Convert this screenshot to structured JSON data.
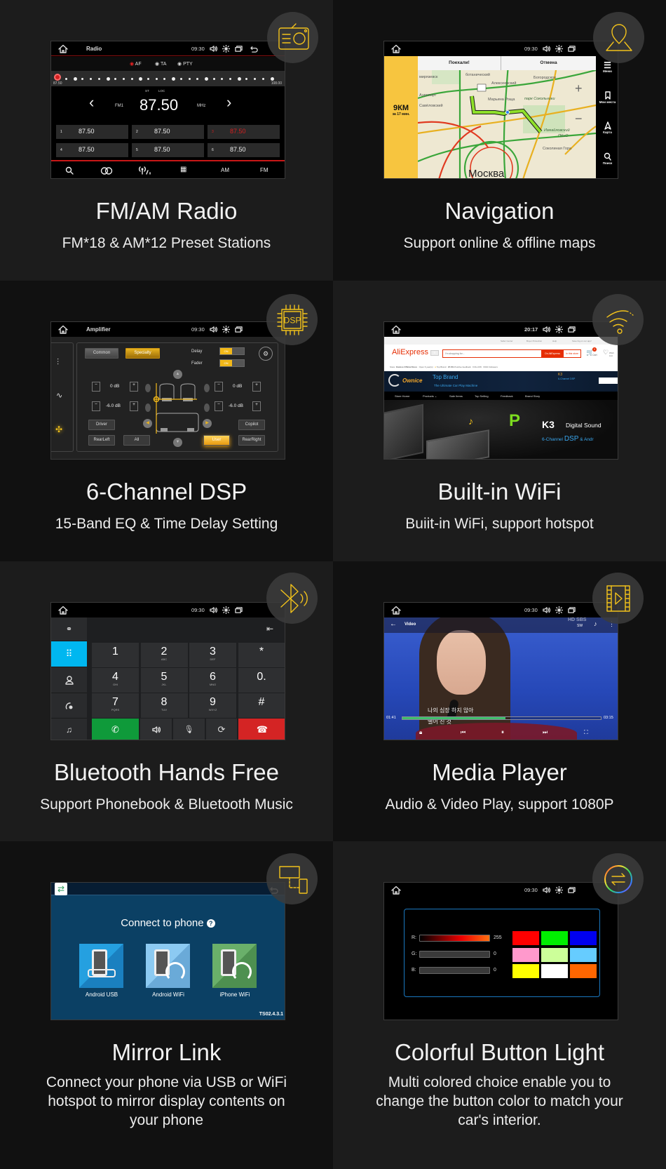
{
  "colors": {
    "accent": "#f2c21b",
    "tile_light": "#1c1c1c",
    "tile_dark": "#111111",
    "radio_red": "#d32020",
    "keypad_cyan": "#00b7f0",
    "call_green": "#0f9a3a",
    "hangup_red": "#d42424",
    "progress_green": "#3fbf6a",
    "aliexpress_red": "#e62e04"
  },
  "features": [
    {
      "title": "FM/AM Radio",
      "subtitle": "FM*18 & AM*12 Preset Stations",
      "icon": "radio-icon"
    },
    {
      "title": "Navigation",
      "subtitle": "Support online & offline maps",
      "icon": "map-pin-icon"
    },
    {
      "title": "6-Channel DSP",
      "subtitle": "15-Band EQ & Time Delay Setting",
      "icon": "dsp-chip-icon"
    },
    {
      "title": "Built-in WiFi",
      "subtitle": "Buiit-in WiFi, support hotspot",
      "icon": "wifi-icon"
    },
    {
      "title": "Bluetooth Hands Free",
      "subtitle": "Support Phonebook & Bluetooth Music",
      "icon": "bluetooth-icon"
    },
    {
      "title": "Media Player",
      "subtitle": "Audio & Video Play, support 1080P",
      "icon": "video-play-icon"
    },
    {
      "title": "Mirror Link",
      "subtitle_lines": [
        "Connect your phone via USB or WiFi",
        "hotspot to mirror display contents on",
        "your phone"
      ],
      "icon": "screen-phone-icon"
    },
    {
      "title": "Colorful Button Light",
      "subtitle_lines": [
        "Multi colored choice enable you to",
        "change the button color to match your",
        "car's interior."
      ],
      "icon": "color-ring-icon"
    }
  ],
  "radio": {
    "title": "Radio",
    "time": "09:30",
    "options": [
      "AF",
      "TA",
      "PTY"
    ],
    "range_min": "87.50",
    "range_max": "108.00",
    "st": "ST",
    "loc": "LOC",
    "band": "FM1",
    "frequency": "87.50",
    "unit": "MHz",
    "presets": [
      {
        "n": "1",
        "v": "87.50"
      },
      {
        "n": "2",
        "v": "87.50"
      },
      {
        "n": "3",
        "v": "87.50",
        "active": true
      },
      {
        "n": "4",
        "v": "87.50"
      },
      {
        "n": "5",
        "v": "87.50"
      },
      {
        "n": "6",
        "v": "87.50"
      }
    ],
    "bottom": [
      "AM",
      "FM"
    ]
  },
  "navigation": {
    "time": "09:30",
    "go": "Поехали!",
    "cancel": "Отмена",
    "distance": "9КМ",
    "eta": "за 17 мин.",
    "side": [
      "Меню",
      "Мои места",
      "Карта",
      "Поиск"
    ],
    "labels": {
      "city": "Москва",
      "park": "парк Сокольники",
      "bog": "Богородское",
      "izm": "Измайловский",
      "pkio": "ПКиО",
      "sok": "Соколиная Гора",
      "aer": "Аэропорт",
      "sav": "Савёловский",
      "alex": "Алексеевский",
      "mar": "Марьина Роща",
      "bot": "ботанический",
      "mir": "мирязевск"
    }
  },
  "dsp": {
    "title": "Amplifier",
    "time": "09:30",
    "modes": [
      "Common",
      "Specialty"
    ],
    "delay": "Delay",
    "fader": "Fader",
    "on": "ON",
    "levels": [
      "0 dB",
      "0 dB",
      "-6.0 dB",
      "-6.0 dB"
    ],
    "buttons": [
      "Driver",
      "Copilot",
      "RearLeft",
      "All",
      "User",
      "RearRight"
    ]
  },
  "wifi": {
    "time": "20:17",
    "topbar": [
      "Seller Center",
      "Buyer Protection",
      "Help",
      "Save big on our app!"
    ],
    "logo": "AliExpress",
    "search_placeholder": "I'm shopping for...",
    "on_ali": "On AliExpress",
    "in_store": "In this store",
    "cart": "Cart",
    "cart_count": "0",
    "wish": "Wish List",
    "store_line": [
      "Store:",
      "Ownice Official Store",
      "Open 6 year(s)",
      "Top Brand",
      "97.6%",
      "Positive feedback",
      "FOLLOW",
      "6332 Followers"
    ],
    "brand": "Ownice",
    "banner_title": "Top Brand",
    "banner_sub": "The Ultimate Car Play Machine",
    "banner_k3": "K3",
    "banner_k3_sub": "6-Channel DSP",
    "nav": [
      "Store Home",
      "Products",
      "Sale Items",
      "Top Selling",
      "Feedback",
      "Brand Story"
    ],
    "hero_k3": "K3",
    "hero_title": "Digital Sound",
    "hero_sub1": "6-Channel",
    "hero_dsp": "DSP",
    "hero_sub2": "& Andr"
  },
  "bluetooth": {
    "time": "09:30",
    "keys": [
      {
        "d": "1",
        "l": ""
      },
      {
        "d": "2",
        "l": "ABC"
      },
      {
        "d": "3",
        "l": "DEF"
      },
      {
        "d": "*",
        "l": ""
      },
      {
        "d": "4",
        "l": "GHI"
      },
      {
        "d": "5",
        "l": "JKL"
      },
      {
        "d": "6",
        "l": "MNO"
      },
      {
        "d": "0.",
        "l": ""
      },
      {
        "d": "7",
        "l": "PQRS"
      },
      {
        "d": "8",
        "l": "TUV"
      },
      {
        "d": "9",
        "l": "WXYZ"
      },
      {
        "d": "#",
        "l": ""
      }
    ]
  },
  "media": {
    "time": "09:30",
    "title": "Video",
    "watermark": "HD SBS",
    "sw": "SW",
    "elapsed": "01:41",
    "total": "03:15",
    "progress": 0.52,
    "subtitle1": "나의 심장 하지 않아",
    "subtitle2": "떨어 진 것"
  },
  "mirror": {
    "heading": "Connect to phone",
    "options": [
      "Android USB",
      "Android WiFi",
      "iPhone WiFi"
    ],
    "version": "TS02.4.3.1"
  },
  "color_light": {
    "time": "09:30",
    "channels": [
      {
        "label": "R:",
        "value": "255",
        "level": 1.0
      },
      {
        "label": "G:",
        "value": "0",
        "level": 0
      },
      {
        "label": "B:",
        "value": "0",
        "level": 0
      }
    ],
    "swatches": [
      "#ff0000",
      "#00ee00",
      "#0000ee",
      "#ff99cc",
      "#ccff99",
      "#66ccff",
      "#ffff00",
      "#ffffff",
      "#ff6600"
    ]
  }
}
